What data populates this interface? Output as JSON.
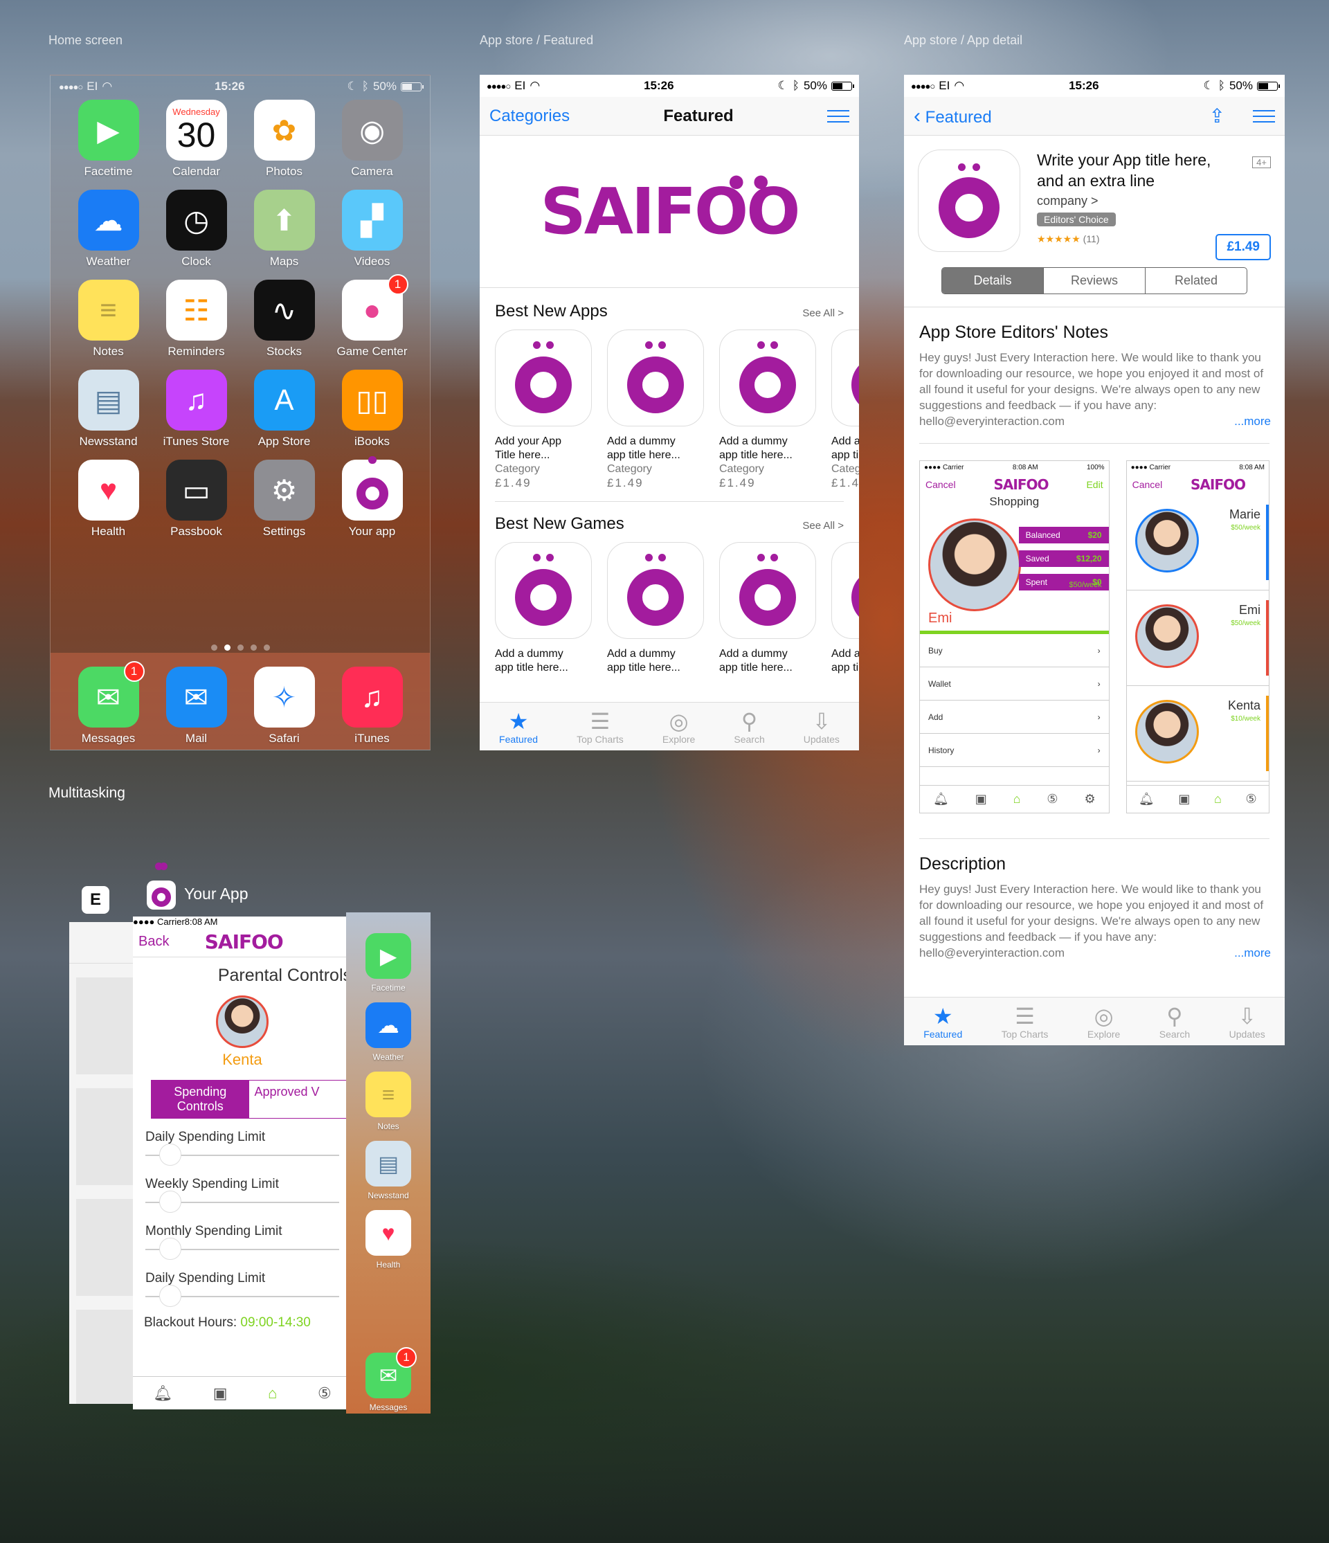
{
  "labels": {
    "home": "Home screen",
    "featured": "App store / Featured",
    "detail": "App store / App detail",
    "multitasking": "Multitasking"
  },
  "status": {
    "carrier": "EI",
    "time": "15:26",
    "battery": "50%"
  },
  "home": {
    "apps": [
      {
        "label": "Facetime",
        "icon": "facetime-icon",
        "color": "#4cd964"
      },
      {
        "label": "Calendar",
        "icon": "calendar-icon",
        "color": "#ffffff",
        "day": "Wednesday",
        "date": "30"
      },
      {
        "label": "Photos",
        "icon": "photos-icon",
        "color": "#ffffff"
      },
      {
        "label": "Camera",
        "icon": "camera-icon",
        "color": "#8e8e93"
      },
      {
        "label": "Weather",
        "icon": "weather-icon",
        "color": "#1a7cf5"
      },
      {
        "label": "Clock",
        "icon": "clock-icon",
        "color": "#111111"
      },
      {
        "label": "Maps",
        "icon": "maps-icon",
        "color": "#a7d08c"
      },
      {
        "label": "Videos",
        "icon": "videos-icon",
        "color": "#5ac8fa"
      },
      {
        "label": "Notes",
        "icon": "notes-icon",
        "color": "#ffe25a"
      },
      {
        "label": "Reminders",
        "icon": "reminders-icon",
        "color": "#ffffff"
      },
      {
        "label": "Stocks",
        "icon": "stocks-icon",
        "color": "#111111"
      },
      {
        "label": "Game Center",
        "icon": "game-center-icon",
        "color": "#ffffff",
        "badge": "1"
      },
      {
        "label": "Newsstand",
        "icon": "newsstand-icon",
        "color": "#d6e4ee"
      },
      {
        "label": "iTunes Store",
        "icon": "itunes-store-icon",
        "color": "#c644fc"
      },
      {
        "label": "App Store",
        "icon": "app-store-icon",
        "color": "#1a9cf5"
      },
      {
        "label": "iBooks",
        "icon": "ibooks-icon",
        "color": "#ff9500"
      },
      {
        "label": "Health",
        "icon": "health-icon",
        "color": "#ffffff"
      },
      {
        "label": "Passbook",
        "icon": "passbook-icon",
        "color": "#2a2a2a"
      },
      {
        "label": "Settings",
        "icon": "settings-icon",
        "color": "#8e8e93"
      },
      {
        "label": "Your app",
        "icon": "your-app-icon",
        "color": "#ffffff"
      }
    ],
    "dock": [
      {
        "label": "Messages",
        "icon": "messages-icon",
        "color": "#4cd964",
        "badge": "1"
      },
      {
        "label": "Mail",
        "icon": "mail-icon",
        "color": "#1a8cf5"
      },
      {
        "label": "Safari",
        "icon": "safari-icon",
        "color": "#ffffff"
      },
      {
        "label": "iTunes",
        "icon": "itunes-icon",
        "color": "#ff2d55"
      }
    ]
  },
  "featured": {
    "nav_left": "Categories",
    "nav_title": "Featured",
    "brand": "SAIFOO",
    "sections": [
      {
        "title": "Best New Apps",
        "see_all": "See All >",
        "items": [
          {
            "line1": "Add your App",
            "line2": "Title here...",
            "category": "Category",
            "price": "£1.49"
          },
          {
            "line1": "Add a dummy",
            "line2": "app title here...",
            "category": "Category",
            "price": "£1.49"
          },
          {
            "line1": "Add a dummy",
            "line2": "app title here...",
            "category": "Category",
            "price": "£1.49"
          },
          {
            "line1": "Add a",
            "line2": "app ti",
            "category": "Categ",
            "price": "£1.4"
          }
        ]
      },
      {
        "title": "Best New Games",
        "see_all": "See All >",
        "items": [
          {
            "line1": "Add a dummy",
            "line2": "app title here..."
          },
          {
            "line1": "Add a dummy",
            "line2": "app title here..."
          },
          {
            "line1": "Add a dummy",
            "line2": "app title here..."
          },
          {
            "line1": "Add a",
            "line2": "app ti"
          }
        ]
      }
    ],
    "tabs": [
      {
        "label": "Featured",
        "icon": "star-icon",
        "glyph": "★",
        "active": true
      },
      {
        "label": "Top Charts",
        "icon": "list-icon",
        "glyph": "☰"
      },
      {
        "label": "Explore",
        "icon": "compass-icon",
        "glyph": "◎"
      },
      {
        "label": "Search",
        "icon": "search-icon",
        "glyph": "⚲"
      },
      {
        "label": "Updates",
        "icon": "download-icon",
        "glyph": "⇩"
      }
    ]
  },
  "detail": {
    "back": "Featured",
    "title_line1": "Write your App title here,",
    "title_line2": "and an extra line",
    "company": "company >",
    "editors_choice": "Editors' Choice",
    "age": "4+",
    "rating_count": "(11)",
    "price": "£1.49",
    "segments": [
      "Details",
      "Reviews",
      "Related"
    ],
    "notes_title": "App Store Editors' Notes",
    "notes_body": "Hey guys! Just Every Interaction here. We would like to thank you for downloading our resource, we hope you enjoyed it and most of all found it useful for your designs. We're always open to any new suggestions and feedback — if you have any: hello@everyinteraction.com",
    "more": "...more",
    "desc_title": "Description",
    "desc_body": "Hey guys! Just Every Interaction here. We would like to thank you for downloading our resource, we hope you enjoyed it and most of all found it useful for your designs. We're always open to any new suggestions and feedback — if you have any: hello@everyinteraction.com",
    "shot1": {
      "carrier": "Carrier",
      "time": "8:08 AM",
      "battery": "100%",
      "cancel": "Cancel",
      "edit": "Edit",
      "heading": "Shopping",
      "name": "Emi",
      "rate": "$50/week",
      "stats": [
        {
          "label": "Balanced",
          "value": "$20"
        },
        {
          "label": "Saved",
          "value": "$12,20"
        },
        {
          "label": "Spent",
          "value": "$0"
        }
      ],
      "rows": [
        "Buy",
        "Wallet",
        "Add",
        "History"
      ]
    },
    "shot2": {
      "carrier": "Carrier",
      "time": "8:08 AM",
      "cancel": "Cancel",
      "people": [
        {
          "name": "Marie",
          "rate": "$50/week"
        },
        {
          "name": "Emi",
          "rate": "$50/week"
        },
        {
          "name": "Kenta",
          "rate": "$10/week"
        }
      ]
    }
  },
  "multitasking": {
    "app_name": "Your App",
    "carrier": "Carrier",
    "time": "8:08 AM",
    "back": "Back",
    "page_title": "Parental Controls",
    "child": "Kenta",
    "tabs": [
      "Spending Controls",
      "Approved V"
    ],
    "controls": [
      "Daily Spending Limit",
      "Weekly Spending Limit",
      "Monthly Spending Limit",
      "Daily Spending Limit"
    ],
    "blackout_label": "Blackout Hours:",
    "blackout_value": "09:00-14:30",
    "side_apps": [
      {
        "label": "Facetime",
        "icon": "facetime-icon",
        "color": "#4cd964"
      },
      {
        "label": "Weather",
        "icon": "weather-icon",
        "color": "#1a7cf5"
      },
      {
        "label": "Notes",
        "icon": "notes-icon",
        "color": "#ffe25a"
      },
      {
        "label": "Newsstand",
        "icon": "newsstand-icon",
        "color": "#d6e4ee"
      },
      {
        "label": "Health",
        "icon": "health-icon",
        "color": "#ffffff"
      },
      {
        "label": "Messages",
        "icon": "messages-icon",
        "color": "#4cd964",
        "badge": "1"
      }
    ]
  },
  "colors": {
    "brand": "#a31c9e",
    "accent": "#1a7cf5",
    "green": "#7ed321"
  }
}
